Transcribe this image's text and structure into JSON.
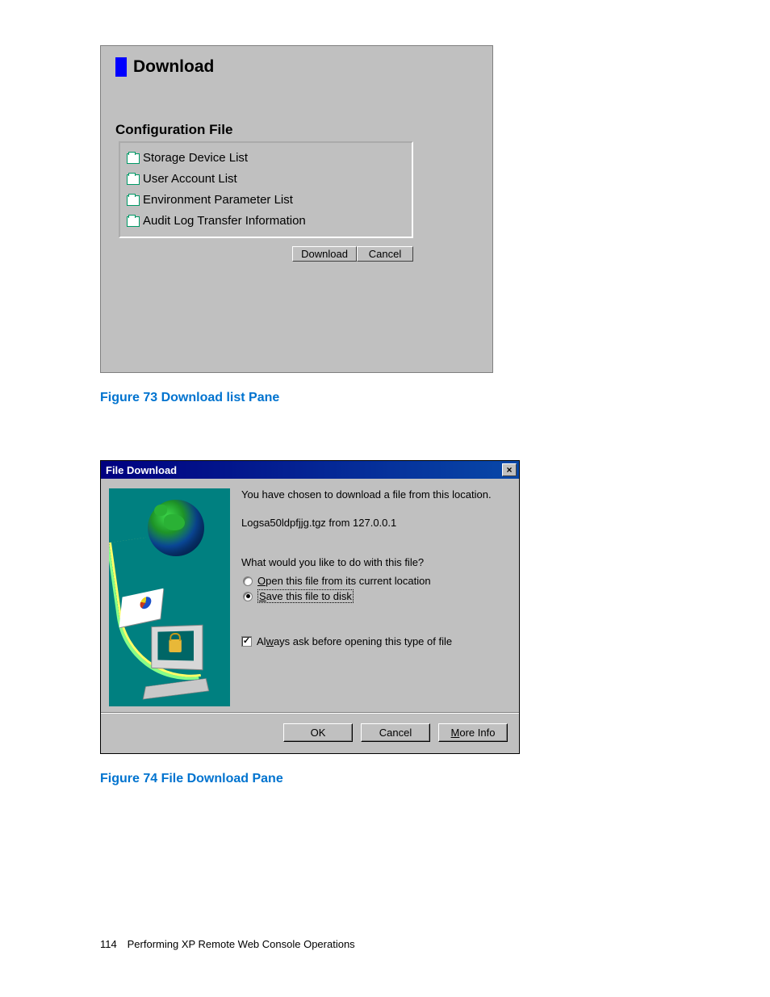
{
  "pane1": {
    "title": "Download",
    "section_label": "Configuration File",
    "items": [
      "Storage Device List",
      "User Account List",
      "Environment Parameter List",
      "Audit Log Transfer Information"
    ],
    "download_btn": "Download",
    "cancel_btn": "Cancel"
  },
  "caption1": "Figure 73 Download list Pane",
  "dialog": {
    "title": "File Download",
    "close": "×",
    "line1": "You have chosen to download a file from this location.",
    "line2": "Logsa50ldpfjjg.tgz from 127.0.0.1",
    "question": "What would you like to do with this file?",
    "opt_open_pre": "O",
    "opt_open_rest": "pen this file from its current location",
    "opt_save_pre": "S",
    "opt_save_rest": "ave this file to disk",
    "check_pre": "Al",
    "check_u": "w",
    "check_rest": "ays ask before opening this type of file",
    "ok": "OK",
    "cancel": "Cancel",
    "more_pre": "M",
    "more_rest": "ore Info"
  },
  "caption2": "Figure 74 File Download Pane",
  "footer": {
    "page": "114",
    "text": "Performing XP Remote Web Console Operations"
  }
}
